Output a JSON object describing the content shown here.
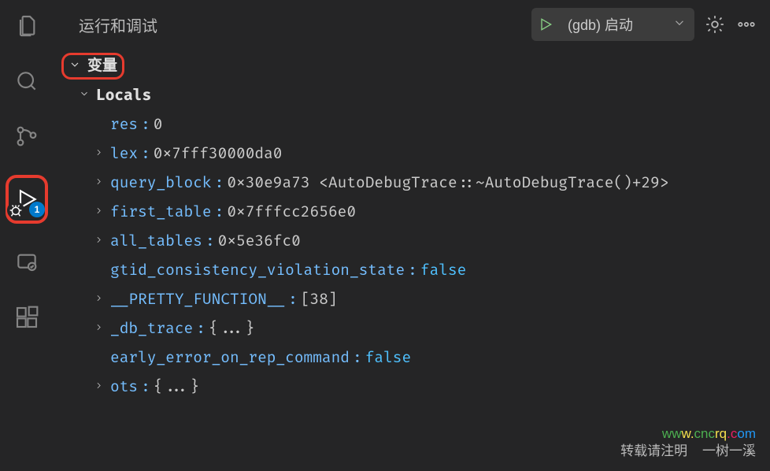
{
  "header": {
    "title": "运行和调试",
    "config": "(gdb) 启动"
  },
  "activity": {
    "debug_badge": "1"
  },
  "sections": {
    "variables": "变量",
    "locals": "Locals"
  },
  "vars": [
    {
      "name": "res",
      "sep": ": ",
      "value": "0",
      "expandable": false
    },
    {
      "name": "lex",
      "sep": ": ",
      "value": "0x7fff30000da0",
      "expandable": true
    },
    {
      "name": "query_block",
      "sep": ": ",
      "value": "0x30e9a73 <AutoDebugTrace::~AutoDebugTrace()+29>",
      "expandable": true
    },
    {
      "name": "first_table",
      "sep": ": ",
      "value": "0x7fffcc2656e0",
      "expandable": true
    },
    {
      "name": "all_tables",
      "sep": ": ",
      "value": "0x5e36fc0",
      "expandable": true
    },
    {
      "name": "gtid_consistency_violation_state",
      "sep": ": ",
      "value": "false",
      "value_class": "keyword",
      "expandable": false
    },
    {
      "name": "__PRETTY_FUNCTION__",
      "sep": ": ",
      "value": "[38]",
      "expandable": true
    },
    {
      "name": "_db_trace",
      "sep": ": ",
      "value": "{...}",
      "expandable": true
    },
    {
      "name": "early_error_on_rep_command",
      "sep": ": ",
      "value": "false",
      "value_class": "keyword",
      "expandable": false
    },
    {
      "name": "ots",
      "sep": ": ",
      "value": "{...}",
      "expandable": true
    }
  ],
  "watermark": {
    "line1": [
      "ww",
      "w.",
      "cnc",
      "rq",
      ".c",
      "om"
    ],
    "line2": "转载请注明    一树一溪"
  }
}
